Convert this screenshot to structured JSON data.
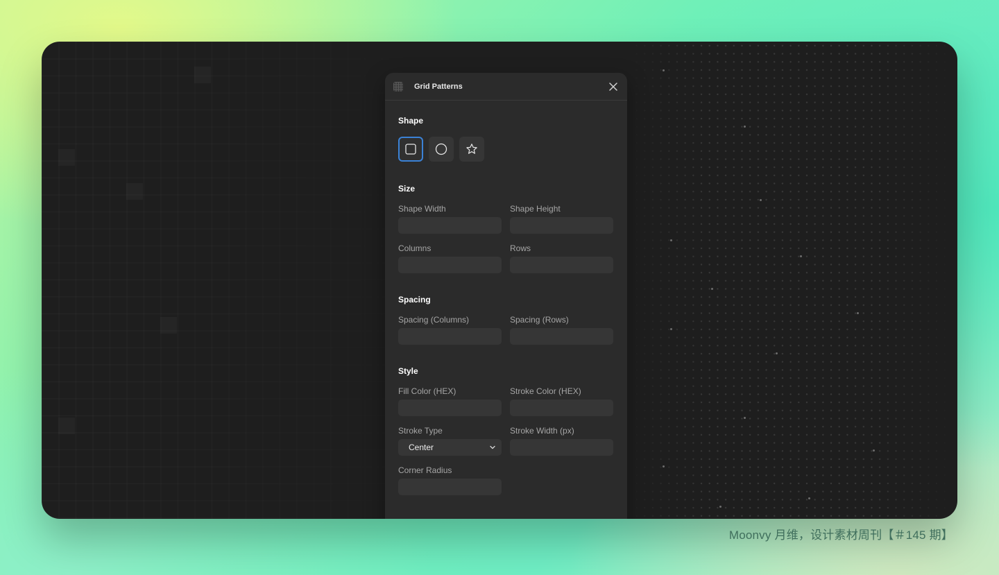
{
  "panel": {
    "title": "Grid Patterns",
    "sections": {
      "shape": {
        "title": "Shape",
        "options": [
          "square-icon",
          "circle-icon",
          "star-icon"
        ],
        "selected": "square"
      },
      "size": {
        "title": "Size",
        "shape_width_label": "Shape Width",
        "shape_height_label": "Shape Height",
        "columns_label": "Columns",
        "rows_label": "Rows"
      },
      "spacing": {
        "title": "Spacing",
        "columns_label": "Spacing (Columns)",
        "rows_label": "Spacing (Rows)"
      },
      "style": {
        "title": "Style",
        "fill_label": "Fill Color (HEX)",
        "stroke_color_label": "Stroke Color (HEX)",
        "stroke_type_label": "Stroke Type",
        "stroke_type_value": "Center",
        "stroke_width_label": "Stroke Width (px)",
        "corner_radius_label": "Corner Radius"
      }
    }
  },
  "caption": "Moonvy 月维，设计素材周刊【＃145 期】",
  "colors": {
    "accent": "#3b82d6",
    "panel_bg": "#2b2b2b",
    "canvas_bg": "#1e1e1e",
    "input_bg": "#363636"
  }
}
